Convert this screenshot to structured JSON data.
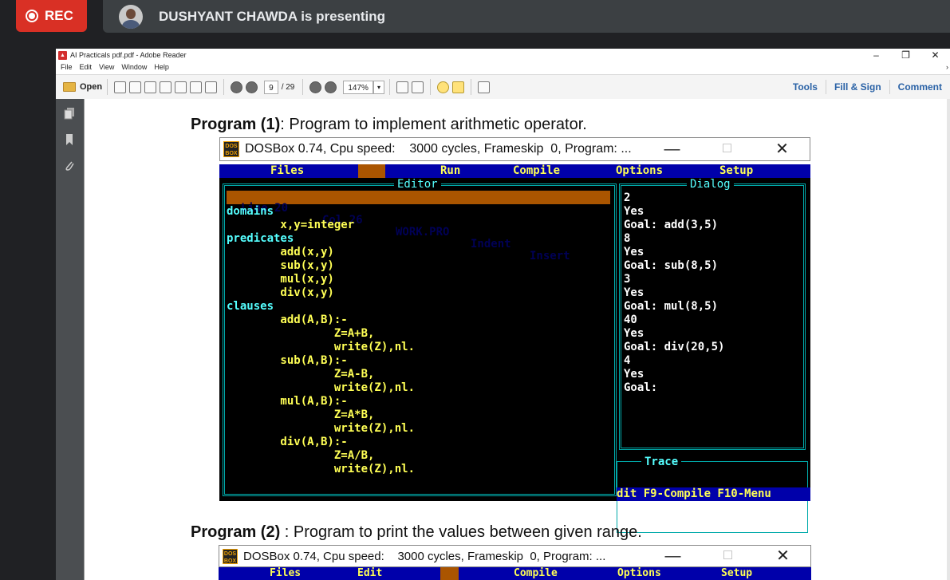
{
  "meeting": {
    "rec_label": "REC",
    "presenter_text": "DUSHYANT CHAWDA is presenting"
  },
  "reader": {
    "title": "AI Practicals pdf.pdf - Adobe Reader",
    "window_buttons": [
      "–",
      "❐",
      "✕"
    ],
    "menu": [
      "File",
      "Edit",
      "View",
      "Window",
      "Help"
    ],
    "menu_overflow": "›",
    "toolbar": {
      "open_label": "Open",
      "page_current": "9",
      "page_total": "/ 29",
      "zoom": "147%",
      "zoom_dropdown": "▾",
      "tools_label": "Tools",
      "fill_sign_label": "Fill & Sign",
      "comment_label": "Comment"
    }
  },
  "page": {
    "program1": {
      "label": "Program (1)",
      "rest": ": Program to implement arithmetic operator."
    },
    "program2": {
      "label": "Program (2)",
      "rest": " : Program to print the values between given range."
    }
  },
  "dosbox": {
    "title": "DOSBox 0.74, Cpu speed:    3000 cycles, Frameskip  0, Program: ...",
    "logo": "DOS BOX",
    "window_buttons": [
      "—",
      "☐",
      "✕"
    ],
    "menu": [
      "Files",
      "Edit",
      "Run",
      "Compile",
      "Options",
      "Setup"
    ],
    "editor_title": "Editor",
    "dialog_title": "Dialog",
    "trace_title": "Trace",
    "status": {
      "line": "Line 20",
      "col": "Col 26",
      "file": "WORK.PRO",
      "indent": "Indent",
      "insert": "Insert"
    },
    "code": [
      "domains",
      "        x,y=integer",
      "predicates",
      "        add(x,y)",
      "        sub(x,y)",
      "        mul(x,y)",
      "        div(x,y)",
      "clauses",
      "        add(A,B):-",
      "                Z=A+B,",
      "                write(Z),nl.",
      "        sub(A,B):-",
      "                Z=A-B,",
      "                write(Z),nl.",
      "        mul(A,B):-",
      "                Z=A*B,",
      "                write(Z),nl.",
      "        div(A,B):-",
      "                Z=A/B,",
      "                write(Z),nl."
    ],
    "dialog": [
      "2",
      "Yes",
      "Goal: add(3,5)",
      "8",
      "Yes",
      "Goal: sub(8,5)",
      "3",
      "Yes",
      "Goal: mul(8,5)",
      "40",
      "Yes",
      "Goal: div(20,5)",
      "4",
      "Yes",
      "Goal:"
    ],
    "hint": "dit F9-Compile F10-Menu"
  },
  "dosbox2": {
    "title": "DOSBox 0.74, Cpu speed:    3000 cycles, Frameskip  0, Program: ...",
    "logo": "DOS BOX",
    "window_buttons": [
      "—",
      "☐",
      "✕"
    ],
    "menu": [
      "Files",
      "Edit",
      "Run",
      "Compile",
      "Options",
      "Setup"
    ]
  }
}
